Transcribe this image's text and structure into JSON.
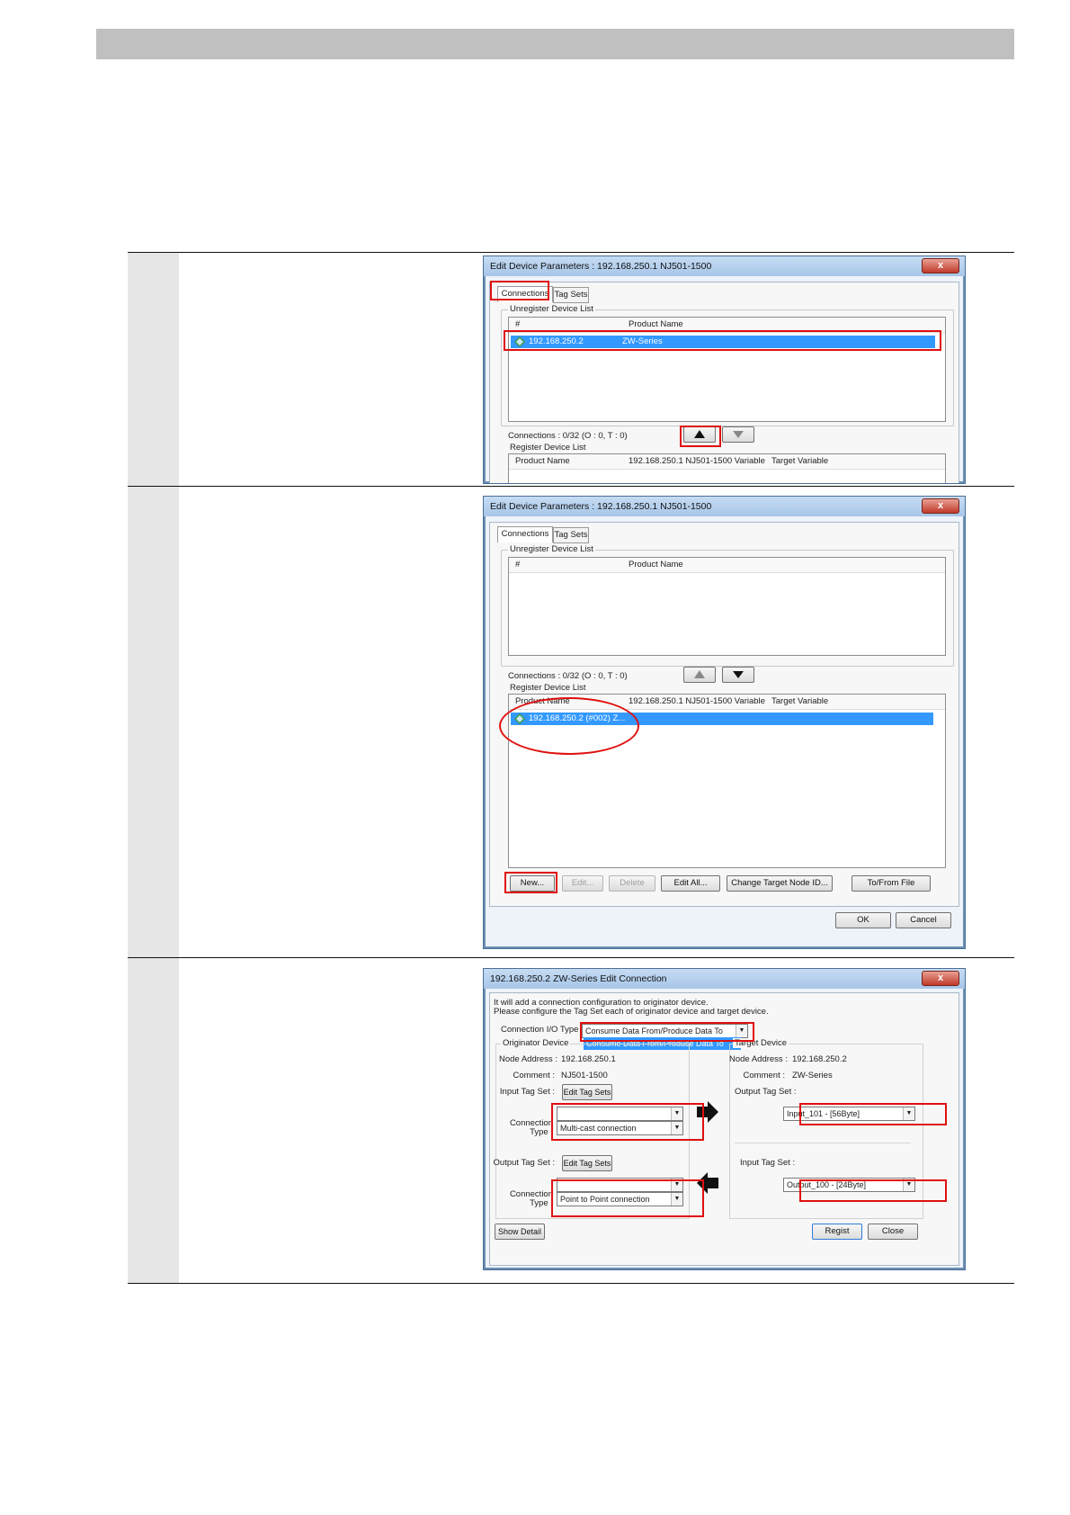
{
  "colors": {
    "red_highlight": "#e01010",
    "selection": "#3399ff",
    "header_bar": "#c0c0c0",
    "step_column": "#e6e6e6"
  },
  "dialog1": {
    "title": "Edit Device Parameters : 192.168.250.1 NJ501-1500",
    "close": "x",
    "tabs": [
      "Connections",
      "Tag Sets"
    ],
    "unregister_label": "Unregister Device List",
    "col_hash": "#",
    "col_product": "Product Name",
    "row": {
      "address": "192.168.250.2",
      "product": "ZW-Series"
    },
    "connections": "Connections :  0/32 (O : 0, T : 0)",
    "register_label": "Register Device List",
    "reg_cols": [
      "Product Name",
      "192.168.250.1 NJ501-1500 Variable",
      "Target Variable"
    ]
  },
  "dialog2": {
    "title": "Edit Device Parameters : 192.168.250.1 NJ501-1500",
    "close": "x",
    "tabs": [
      "Connections",
      "Tag Sets"
    ],
    "unregister_label": "Unregister Device List",
    "col_hash": "#",
    "col_product": "Product Name",
    "connections": "Connections :  0/32 (O : 0, T : 0)",
    "register_label": "Register Device List",
    "reg_cols": [
      "Product Name",
      "192.168.250.1 NJ501-1500 Variable",
      "Target Variable"
    ],
    "reg_row": "192.168.250.2 (#002) Z...",
    "buttons": [
      "New...",
      "Edit...",
      "Delete",
      "Edit All...",
      "Change Target Node ID...",
      "To/From File"
    ],
    "ok": "OK",
    "cancel": "Cancel"
  },
  "dialog3": {
    "title": "192.168.250.2 ZW-Series Edit Connection",
    "close": "x",
    "info1": "It will add a connection configuration to originator device.",
    "info2": "Please configure the Tag Set each of originator device and target device.",
    "conn_type_label": "Connection I/O Type :",
    "conn_type_value": "Consume Data From/Produce Data To",
    "conn_type_option": "Consume Data From/Produce Data To",
    "originator_label": "Originator Device",
    "target_label": "Target Device",
    "node_address_label": "Node Address :",
    "orig_node": "192.168.250.1",
    "comment_label": "Comment :",
    "orig_comment": "NJ501-1500",
    "input_tag_label": "Input Tag Set :",
    "output_tag_label": "Output Tag Set :",
    "edit_tag_sets": "Edit Tag Sets",
    "connection_type_label1": "Connection",
    "connection_type_label2": "Type :",
    "orig_input_conn": "Multi-cast connection",
    "orig_output_conn": "Point to Point connection",
    "tgt_node": "192.168.250.2",
    "tgt_comment": "ZW-Series",
    "tgt_output_label": "Output Tag Set :",
    "tgt_output_value": "Input_101 - [56Byte]",
    "tgt_input_label": "Input Tag Set :",
    "tgt_input_value": "Output_100 - [24Byte]",
    "show_detail": "Show Detail",
    "regist": "Regist",
    "close_btn": "Close"
  }
}
